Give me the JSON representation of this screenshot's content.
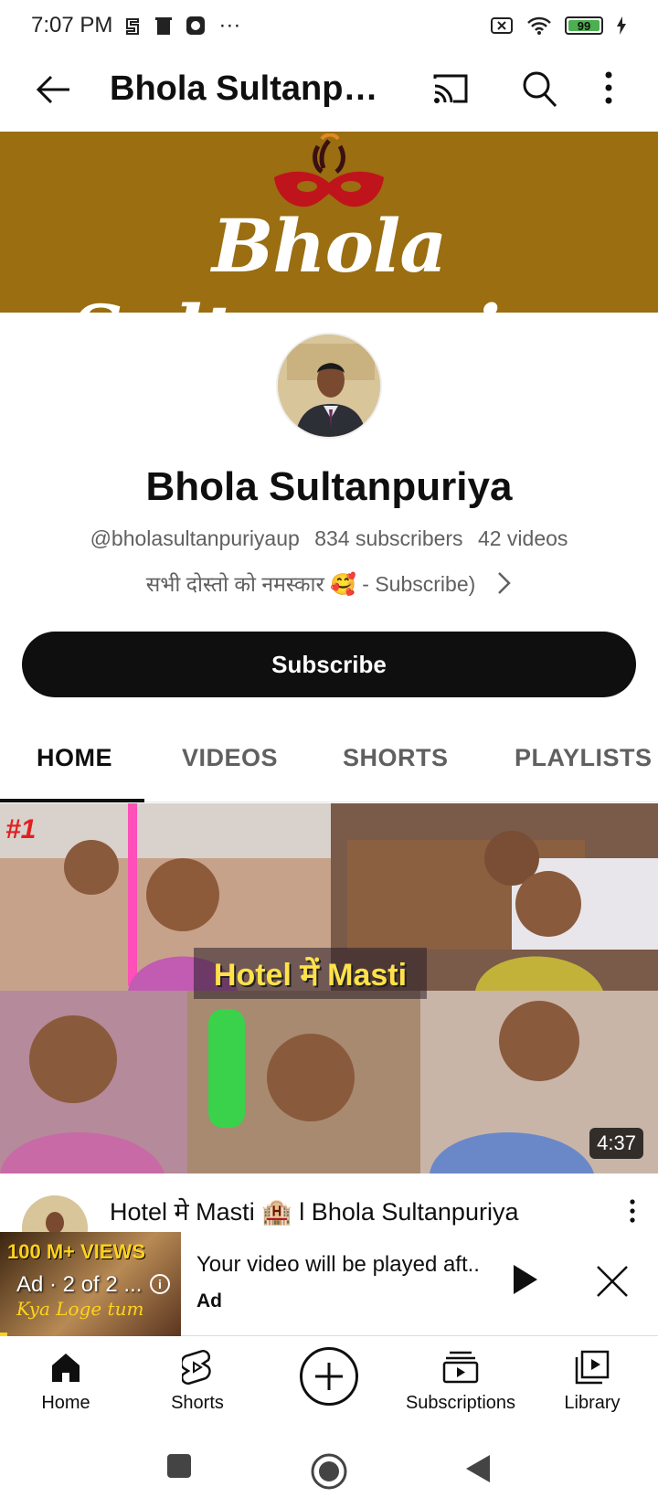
{
  "status_bar": {
    "time": "7:07 PM",
    "more_dots": "···",
    "battery": "99"
  },
  "app_bar": {
    "title": "Bhola Sultanpur..."
  },
  "banner": {
    "logo_text": "Bhola Sultanpuriya"
  },
  "channel": {
    "name": "Bhola Sultanpuriya",
    "handle": "@bholasultanpuriyaup",
    "subscribers": "834 subscribers",
    "videos": "42 videos",
    "description": "सभी दोस्तो को नमस्कार 🥰 - Subscribe)",
    "subscribe_label": "Subscribe"
  },
  "tabs": [
    {
      "label": "HOME",
      "active": true
    },
    {
      "label": "VIDEOS",
      "active": false
    },
    {
      "label": "SHORTS",
      "active": false
    },
    {
      "label": "PLAYLISTS",
      "active": false
    }
  ],
  "featured_video": {
    "thumbnail_caption": "Hotel में Masti",
    "rank_badge": "#1",
    "duration": "4:37",
    "title": "Hotel मे Masti 🏨 l Bhola Sultanpuriya"
  },
  "ad": {
    "thumb_views": "100 M+ VIEWS",
    "thumb_label": "Ad · 2 of 2 ...",
    "thumb_script": "Kya Loge tum",
    "text": "Your video will be played aft..",
    "sub": "Ad"
  },
  "bottom_nav": {
    "home": "Home",
    "shorts": "Shorts",
    "subscriptions": "Subscriptions",
    "library": "Library"
  },
  "colors": {
    "banner": "#9a6e11",
    "subscribe_bg": "#0f0f0f",
    "caption_yellow": "#ffe14a"
  }
}
